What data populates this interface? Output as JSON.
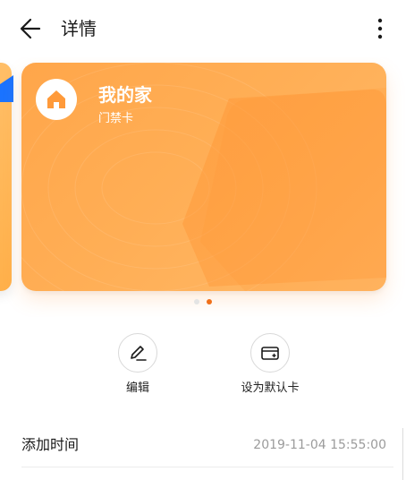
{
  "header": {
    "title": "详情",
    "back_icon": "back-arrow-icon",
    "more_icon": "more-vertical-icon"
  },
  "card": {
    "name": "我的家",
    "type": "门禁卡",
    "icon": "home-icon",
    "colors": {
      "primary": "#ffa64a",
      "light": "#ffb968",
      "deep": "#ff9433"
    }
  },
  "pager": {
    "count": 2,
    "active_index": 1,
    "active_color": "#f07019"
  },
  "actions": [
    {
      "label": "编辑",
      "icon": "edit-pencil-icon"
    },
    {
      "label": "设为默认卡",
      "icon": "card-default-icon"
    }
  ],
  "details": [
    {
      "label": "添加时间",
      "value": "2019-11-04 15:55:00"
    }
  ]
}
